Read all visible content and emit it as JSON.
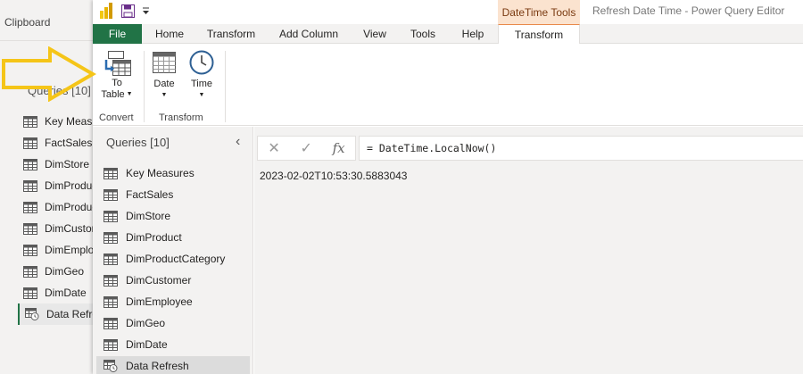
{
  "background_window": {
    "clipboard_label": "Clipboard",
    "queries_title": "Queries [10]",
    "items": [
      {
        "label": "Key Measures"
      },
      {
        "label": "FactSales"
      },
      {
        "label": "DimStore"
      },
      {
        "label": "DimProduct"
      },
      {
        "label": "DimProductCategory"
      },
      {
        "label": "DimCustomer"
      },
      {
        "label": "DimEmployee"
      },
      {
        "label": "DimGeo"
      },
      {
        "label": "DimDate"
      },
      {
        "label": "Data Refresh"
      }
    ]
  },
  "titlebar": {
    "contextual_group": "DateTime Tools",
    "window_title": "Refresh Date Time - Power Query Editor"
  },
  "tabs": {
    "file": "File",
    "home": "Home",
    "transform": "Transform",
    "add_column": "Add Column",
    "view": "View",
    "tools": "Tools",
    "help": "Help",
    "context_transform": "Transform"
  },
  "ribbon": {
    "to_table_line1": "To",
    "to_table_line2": "Table",
    "date_label": "Date",
    "time_label": "Time",
    "group_convert": "Convert",
    "group_transform": "Transform"
  },
  "queries_pane": {
    "title": "Queries [10]",
    "collapse_glyph": "‹",
    "items": [
      {
        "label": "Key Measures"
      },
      {
        "label": "FactSales"
      },
      {
        "label": "DimStore"
      },
      {
        "label": "DimProduct"
      },
      {
        "label": "DimProductCategory"
      },
      {
        "label": "DimCustomer"
      },
      {
        "label": "DimEmployee"
      },
      {
        "label": "DimGeo"
      },
      {
        "label": "DimDate"
      },
      {
        "label": "Data Refresh"
      }
    ],
    "active_item": "Data Refresh"
  },
  "formula_bar": {
    "cancel_glyph": "✕",
    "confirm_glyph": "✓",
    "fx_glyph": "fx",
    "formula": "= DateTime.LocalNow()"
  },
  "result": {
    "value": "2023-02-02T10:53:30.5883043"
  },
  "colors": {
    "file_tab": "#217346",
    "context_tab_bg": "#fbe3cf",
    "arrow": "#f5c518"
  },
  "icons": {
    "app": "power-bi-icon",
    "save": "save-icon",
    "qat_dropdown": "dropdown-icon",
    "to_table": "to-table-icon",
    "date": "calendar-icon",
    "time": "clock-icon",
    "table": "table-icon",
    "refresh_table": "table-clock-icon"
  }
}
